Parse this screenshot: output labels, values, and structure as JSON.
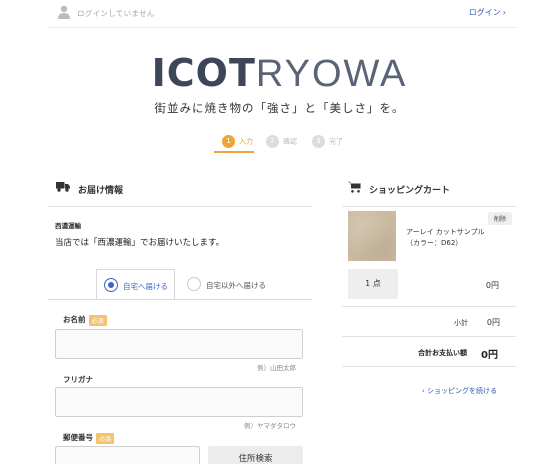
{
  "header": {
    "login_status": "ログインしていません",
    "login_label": "ログイン",
    "login_chevron": "›"
  },
  "brand": {
    "logo_bold": "ICOT",
    "logo_light": "RYOWA",
    "tagline": "街並みに焼き物の「強さ」と「美しさ」を。"
  },
  "steps": [
    {
      "num": "1",
      "label": "入力",
      "active": true
    },
    {
      "num": "2",
      "label": "確認",
      "active": false
    },
    {
      "num": "3",
      "label": "完了",
      "active": false
    }
  ],
  "delivery": {
    "title": "お届け情報",
    "carrier_label": "西濃運輸",
    "carrier_text": "当店では「西濃運輸」でお届けいたします。",
    "tabs": [
      {
        "label": "自宅へ届ける",
        "selected": true
      },
      {
        "label": "自宅以外へ届ける",
        "selected": false
      }
    ],
    "fields": {
      "name": {
        "label": "お名前",
        "required": "必須",
        "value": "",
        "example": "例）山田太郎"
      },
      "kana": {
        "label": "フリガナ",
        "value": "",
        "example": "例）ヤマダタロウ"
      },
      "postal": {
        "label": "郵便番号",
        "required": "必須",
        "value": ""
      }
    },
    "address_search_label": "住所検索"
  },
  "cart": {
    "title": "ショッピングカート",
    "item": {
      "name_line1": "アーレイ カットサンプル",
      "name_line2": "（カラー：D62）",
      "delete_label": "削除",
      "quantity": "1 点",
      "price": "0円"
    },
    "subtotal_label": "小計",
    "subtotal_value": "0円",
    "total_label": "合計お支払い額",
    "total_value": "0円",
    "continue_label": "‹  ショッピングを続ける"
  },
  "colors": {
    "accent_orange": "#f0a336",
    "link_blue": "#2f56a8",
    "radio_blue": "#3b63c2",
    "required_badge": "#f3c46b"
  }
}
